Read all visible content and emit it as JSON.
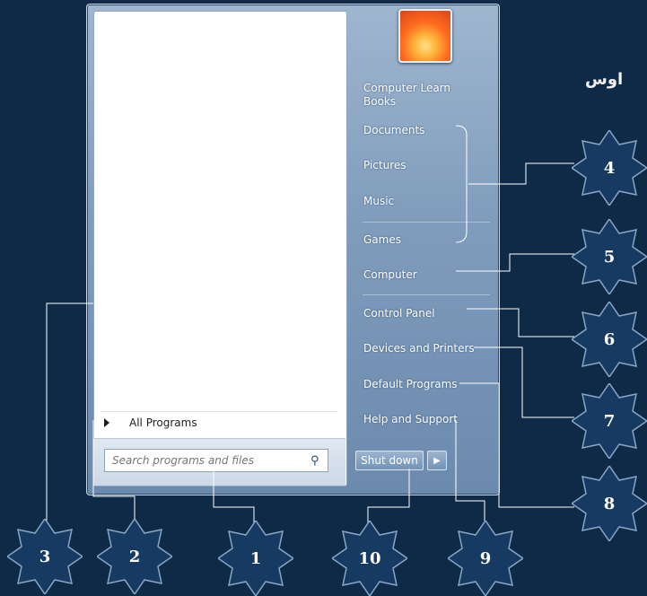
{
  "start_menu": {
    "all_programs_label": "All Programs",
    "search_placeholder": "Search programs and files",
    "user_label": "Computer Learn Books",
    "right_items": [
      "Documents",
      "Pictures",
      "Music",
      "Games",
      "Computer",
      "Control Panel",
      "Devices and Printers",
      "Default Programs",
      "Help and Support"
    ],
    "shutdown_label": "Shut down"
  },
  "heading_fragment": "اوس",
  "callouts": [
    "1",
    "2",
    "3",
    "4",
    "5",
    "6",
    "7",
    "8",
    "9",
    "10"
  ],
  "colors": {
    "background": "#0f2a47",
    "badge_fill": "#173a63",
    "leader_line": "#ffffff"
  }
}
